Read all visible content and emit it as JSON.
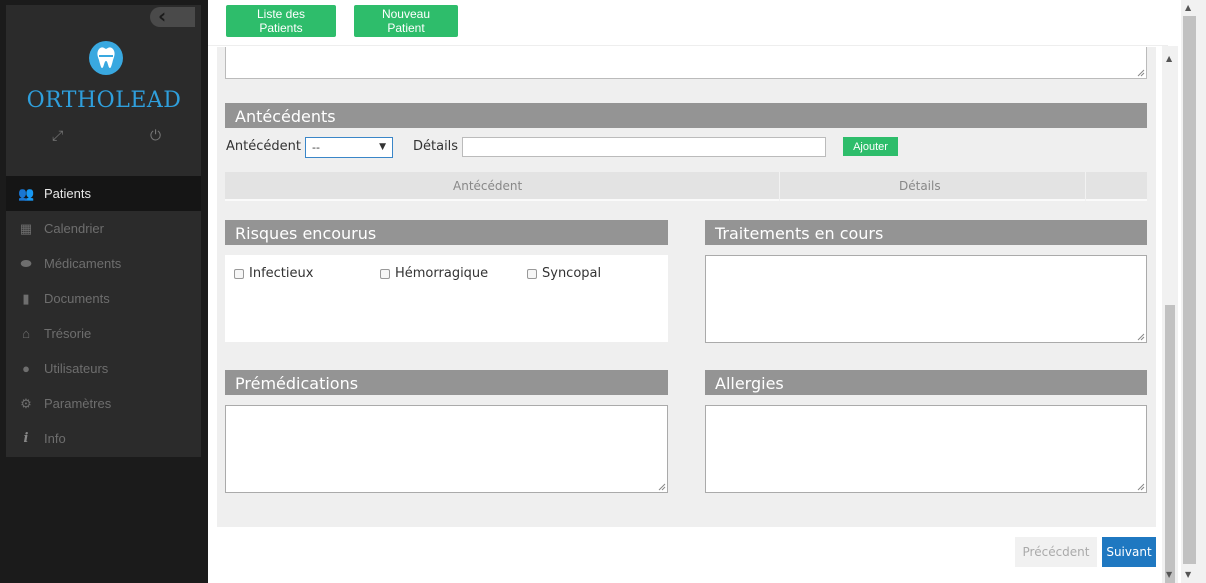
{
  "sidebar": {
    "brand": "ORTHOLEAD",
    "items": [
      {
        "label": "Patients",
        "icon": "patients-icon",
        "active": true
      },
      {
        "label": "Calendrier",
        "icon": "calendar-icon"
      },
      {
        "label": "Médicaments",
        "icon": "pill-icon"
      },
      {
        "label": "Documents",
        "icon": "document-icon"
      },
      {
        "label": "Trésorie",
        "icon": "treasury-icon"
      },
      {
        "label": "Utilisateurs",
        "icon": "user-icon"
      },
      {
        "label": "Paramètres",
        "icon": "settings-icon"
      },
      {
        "label": "Info",
        "icon": "info-icon"
      }
    ]
  },
  "topbar": {
    "liste_label": "Liste des Patients",
    "nouveau_label": "Nouveau Patient"
  },
  "antecedents": {
    "title": "Antécédents",
    "antecedent_label": "Antécédent",
    "select_value": "--",
    "details_label": "Détails",
    "add_label": "Ajouter",
    "columns": [
      "Antécédent",
      "Détails"
    ]
  },
  "risques": {
    "title": "Risques encourus",
    "options": [
      "Infectieux",
      "Hémorragique",
      "Syncopal"
    ]
  },
  "traitements": {
    "title": "Traitements en cours"
  },
  "premedications": {
    "title": "Prémédications"
  },
  "allergies": {
    "title": "Allergies"
  },
  "footer": {
    "prev_label": "Précécdent",
    "next_label": "Suivant"
  },
  "colors": {
    "accent_green": "#2ebd6b",
    "accent_blue": "#1f78c1",
    "brand_blue": "#2f9fdc",
    "section_gray": "#949494"
  }
}
